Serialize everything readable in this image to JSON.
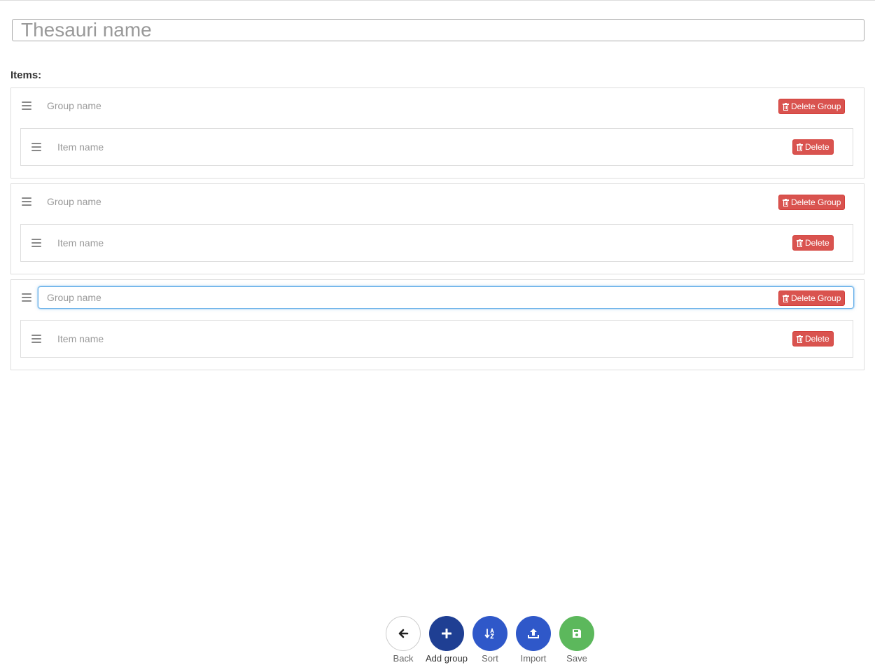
{
  "thesauri": {
    "name_placeholder": "Thesauri name",
    "name_value": ""
  },
  "items_label": "Items:",
  "groups": [
    {
      "name_placeholder": "Group name",
      "name_value": "",
      "delete_label": "Delete Group",
      "items": [
        {
          "name_placeholder": "Item name",
          "name_value": "",
          "delete_label": "Delete"
        }
      ]
    },
    {
      "name_placeholder": "Group name",
      "name_value": "",
      "delete_label": "Delete Group",
      "items": [
        {
          "name_placeholder": "Item name",
          "name_value": "",
          "delete_label": "Delete"
        }
      ]
    },
    {
      "name_placeholder": "Group name",
      "name_value": "",
      "focused": true,
      "delete_label": "Delete Group",
      "items": [
        {
          "name_placeholder": "Item name",
          "name_value": "",
          "delete_label": "Delete"
        }
      ]
    }
  ],
  "actions": {
    "back": {
      "label": "Back",
      "icon": "arrow-left-icon"
    },
    "add_group": {
      "label": "Add group",
      "icon": "plus-icon"
    },
    "sort": {
      "label": "Sort",
      "icon": "sort-alpha-icon"
    },
    "import": {
      "label": "Import",
      "icon": "upload-icon"
    },
    "save": {
      "label": "Save",
      "icon": "save-icon"
    }
  },
  "colors": {
    "danger": "#d9534f",
    "add_group": "#1f3f93",
    "primary": "#2f58c9",
    "save": "#5cb85c",
    "focus": "#66afe9"
  }
}
